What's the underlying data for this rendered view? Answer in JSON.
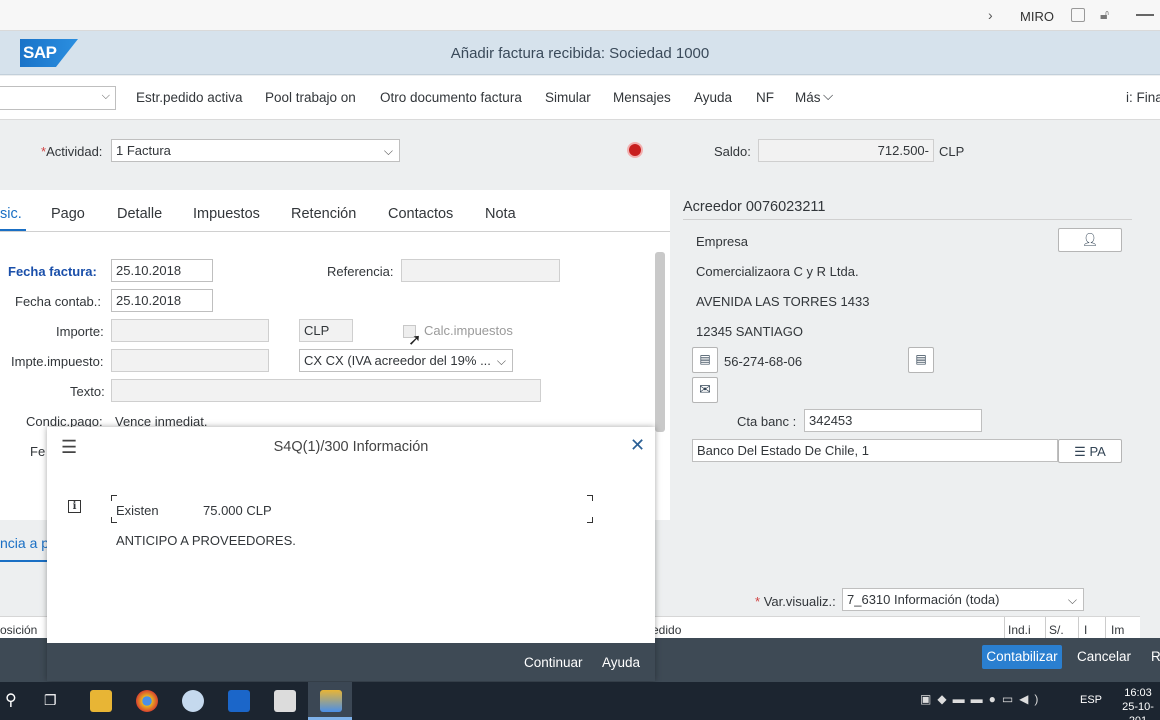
{
  "system_bar": {
    "tcode": "MIRO",
    "chevron": "›"
  },
  "app": {
    "logo": "SAP",
    "title": "Añadir factura recibida: Sociedad 1000"
  },
  "toolbar": {
    "items": [
      "Estr.pedido activa",
      "Pool trabajo on",
      "Otro documento factura",
      "Simular",
      "Mensajes",
      "Ayuda",
      "NF",
      "Más"
    ],
    "more_chevron": "⌵",
    "right_text": "i: Fina"
  },
  "header": {
    "activity_label": "Actividad:",
    "activity_value": "1 Factura",
    "balance_label": "Saldo:",
    "balance_value": "712.500-",
    "balance_currency": "CLP"
  },
  "tabs": [
    "sic.",
    "Pago",
    "Detalle",
    "Impuestos",
    "Retención",
    "Contactos",
    "Nota"
  ],
  "form": {
    "invoice_date_label": "Fecha factura:",
    "invoice_date": "25.10.2018",
    "reference_label": "Referencia:",
    "posting_date_label": "Fecha contab.:",
    "posting_date": "25.10.2018",
    "amount_label": "Importe:",
    "currency": "CLP",
    "calc_tax_label": "Calc.impuestos",
    "tax_amount_label": "Impte.impuesto:",
    "tax_code": "CX CX (IVA acreedor del 19% ...",
    "text_label": "Texto:",
    "payment_terms_label": "Condic.pago:",
    "payment_terms_value": "Vence inmediat.",
    "partial_label": "Fe",
    "partial_link": "ncia a p"
  },
  "vendor": {
    "title": "Acreedor 0076023211",
    "company_label": "Empresa",
    "name": "Comercializaora C y R Ltda.",
    "street": "AVENIDA LAS TORRES 1433",
    "city": "12345 SANTIAGO",
    "tax_id": "56-274-68-06",
    "bank_account_label": "Cta banc :",
    "bank_account": "342453",
    "bank_name": "Banco Del Estado De Chile, 1",
    "pa_button": "PA"
  },
  "lower": {
    "layout_label": "Var.visualiz.:",
    "layout_value": "7_6310 Información (toda)",
    "col_left": "osición",
    "col_mid": "edido",
    "cols_right": [
      "Ind.i",
      "S/.",
      "I",
      "Im"
    ]
  },
  "footer": {
    "post_button": "Contabilizar",
    "cancel": "Cancelar",
    "right_cut": "R"
  },
  "dialog": {
    "title": "S4Q(1)/300 Información",
    "line1_label": "Existen",
    "line1_value": "75.000 CLP",
    "line2": "ANTICIPO A PROVEEDORES.",
    "continue_button": "Continuar",
    "help_button": "Ayuda"
  },
  "taskbar": {
    "lang": "ESP",
    "time": "16:03",
    "date": "25-10-201"
  },
  "colors": {
    "shell": "#d6e2ec",
    "accent": "#2a7fd0",
    "footer": "#3e4a55",
    "required_label": "#1a4faa"
  }
}
